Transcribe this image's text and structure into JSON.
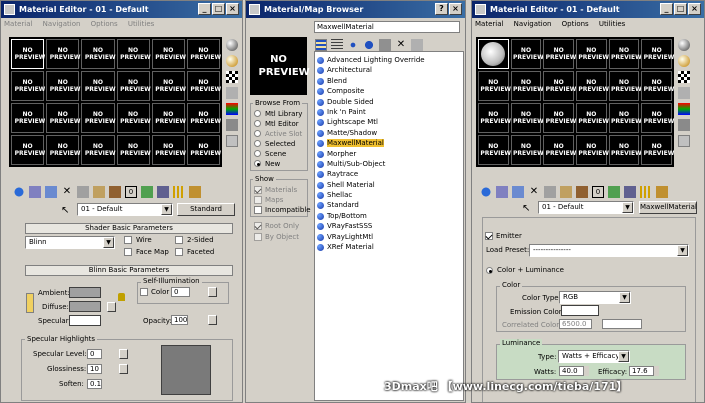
{
  "left_editor": {
    "title": "Material Editor - 01 - Default",
    "menu": [
      "Material",
      "Navigation",
      "Options",
      "Utilities"
    ],
    "slot_label": "NO PREVIEW",
    "material_name": "01 - Default",
    "material_type": "Standard",
    "shader_rollout": "Shader Basic Parameters",
    "shader_type": "Blinn",
    "wire_label": "Wire",
    "two_sided_label": "2-Sided",
    "face_map_label": "Face Map",
    "faceted_label": "Faceted",
    "blinn_rollout": "Blinn Basic Parameters",
    "self_illum_label": "Self-Illumination",
    "color_label": "Color",
    "color_value": "0",
    "ambient_label": "Ambient:",
    "diffuse_label": "Diffuse:",
    "specular_label": "Specular:",
    "opacity_label": "Opacity:",
    "opacity_value": "100",
    "specular_highlights_label": "Specular Highlights",
    "specular_level_label": "Specular Level:",
    "specular_level_value": "0",
    "glossiness_label": "Glossiness:",
    "glossiness_value": "10",
    "soften_label": "Soften:",
    "soften_value": "0.1"
  },
  "browser": {
    "title": "Material/Map Browser",
    "name_field": "MaxwellMaterial",
    "preview_label": "NO PREVIEW",
    "browse_from_label": "Browse From",
    "browse_options": [
      "Mtl Library",
      "Mtl Editor",
      "Active Slot",
      "Selected",
      "Scene",
      "New"
    ],
    "show_label": "Show",
    "show_options": [
      "Materials",
      "Maps",
      "Incompatible"
    ],
    "root_only": "Root Only",
    "by_object": "By Object",
    "items": [
      "Advanced Lighting Override",
      "Architectural",
      "Blend",
      "Composite",
      "Double Sided",
      "Ink 'n Paint",
      "Lightscape Mtl",
      "Matte/Shadow",
      "MaxwellMaterial",
      "Morpher",
      "Multi/Sub-Object",
      "Raytrace",
      "Shell Material",
      "Shellac",
      "Standard",
      "Top/Bottom",
      "VRayFastSSS",
      "VRayLightMtl",
      "XRef Material"
    ]
  },
  "right_editor": {
    "title": "Material Editor - 01 - Default",
    "menu": [
      "Material",
      "Navigation",
      "Options",
      "Utilities"
    ],
    "slot_label": "NO PREVIEW",
    "material_name": "01 - Default",
    "material_type": "MaxwellMaterial",
    "emitter_label": "Emitter",
    "load_preset_label": "Load Preset:",
    "load_preset_value": "---------------",
    "color_luminance_label": "Color + Luminance",
    "color_group": "Color",
    "color_type_label": "Color Type:",
    "color_type_value": "RGB",
    "emission_color_label": "Emission Color:",
    "correlated_color_label": "Correlated Color:",
    "correlated_color_value": "6500.0",
    "luminance_group": "Luminance",
    "type_label": "Type:",
    "type_value": "Watts + Efficacy",
    "watts_label": "Watts:",
    "watts_value": "40.0",
    "efficacy_label": "Efficacy:",
    "efficacy_value": "17.6"
  },
  "watermark": "3Dmax吧 【www.linecg.com/tieba/171】"
}
